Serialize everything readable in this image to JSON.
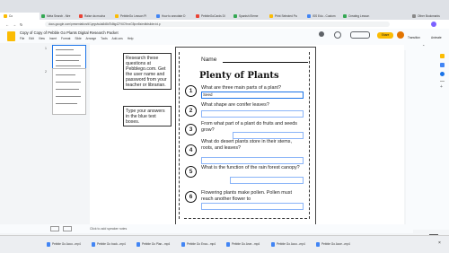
{
  "browser": {
    "tabs": [
      {
        "label": "Co",
        "color": "#4285f4"
      },
      {
        "label": "Meta Search - Mre",
        "color": "#34a853"
      },
      {
        "label": "Raise da mucha",
        "color": "#ea4335"
      },
      {
        "label": "PebbleGo Lesson Pl",
        "color": "#fbbc04"
      },
      {
        "label": "How to annotate D",
        "color": "#4285f4"
      },
      {
        "label": "PebbleGoCards Dl",
        "color": "#ea4335"
      },
      {
        "label": "Spanish Eleme",
        "color": "#34a853"
      },
      {
        "label": "Print Selected Pa",
        "color": "#fbbc04"
      },
      {
        "label": "ISS Edu - Custom",
        "color": "#4285f4"
      },
      {
        "label": "Creating Lesson",
        "color": "#34a853"
      },
      {
        "label": "Other Bookmarks",
        "color": "#888888"
      }
    ],
    "url": "docs.google.com/presentation/d/1yrgslw4a8d8d7k8tg4ZY6C9rxxG5pxr8s/edit#slide=id.p",
    "bookmarks_label": "Other Bookmarks"
  },
  "docs": {
    "title": "Copy of Copy of Pebble Go Plants Digital Research Packet",
    "menus": [
      "File",
      "Edit",
      "View",
      "Insert",
      "Format",
      "Slide",
      "Arrange",
      "Tools",
      "Add-ons",
      "Help"
    ],
    "share_label": "Share",
    "slide_numbers": [
      "1",
      "2"
    ],
    "speaker_notes_placeholder": "Click to add speaker notes",
    "right_panel_labels": [
      "Transition",
      "Animate"
    ]
  },
  "slide": {
    "note1": "Research these questions at Pebblego.com. Get the user name and password from your teacher or librarian.",
    "note1_link": "Pebblego.com",
    "note2": "Type your answers in the blue text boxes.",
    "worksheet": {
      "name_label": "Name",
      "title": "Plenty of Plants",
      "questions": [
        {
          "num": "1",
          "text": "What are three main parts of a plant?",
          "answer": "Seed"
        },
        {
          "num": "2",
          "text": "What shape are conifer leaves?",
          "answer": ""
        },
        {
          "num": "3",
          "text": "From what part of a plant do fruits and seeds grow?",
          "answer": ""
        },
        {
          "num": "4",
          "text": "What do desert plants store in their stems, roots, and leaves?",
          "answer": ""
        },
        {
          "num": "5",
          "text": "What is the function of the rain forest canopy?",
          "answer": ""
        },
        {
          "num": "6",
          "text": "Flowering plants make pollen. Pollen must reach another flower to",
          "answer": ""
        }
      ]
    }
  },
  "downloads": [
    "Pebble Go Acco...mp4",
    "Pebble Go book...mp4",
    "Pebble Go Plan...mp4",
    "Pebble Go Enco...mp4",
    "Pebble Go Arce...mp4",
    "Pebble Go Acco...mp4",
    "Pebble Go Acce...mp4"
  ]
}
